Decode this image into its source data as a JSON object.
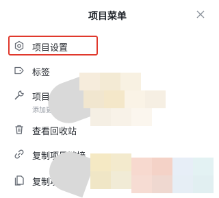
{
  "header": {
    "title": "项目菜单"
  },
  "menu": {
    "items": [
      {
        "label": "项目设置",
        "icon": "gear-icon"
      },
      {
        "label": "标签",
        "icon": "tag-icon"
      },
      {
        "label": "项目",
        "icon": "wrench-icon",
        "sub": "添加更"
      },
      {
        "label": "查看回收站",
        "icon": "trash-icon"
      },
      {
        "label": "复制项目链接",
        "icon": "link-icon"
      },
      {
        "label": "复制项",
        "icon": "copy-icon"
      }
    ]
  },
  "colors": {
    "highlight": "#e0382c",
    "text": "#1f2329",
    "icon": "#646a73"
  }
}
